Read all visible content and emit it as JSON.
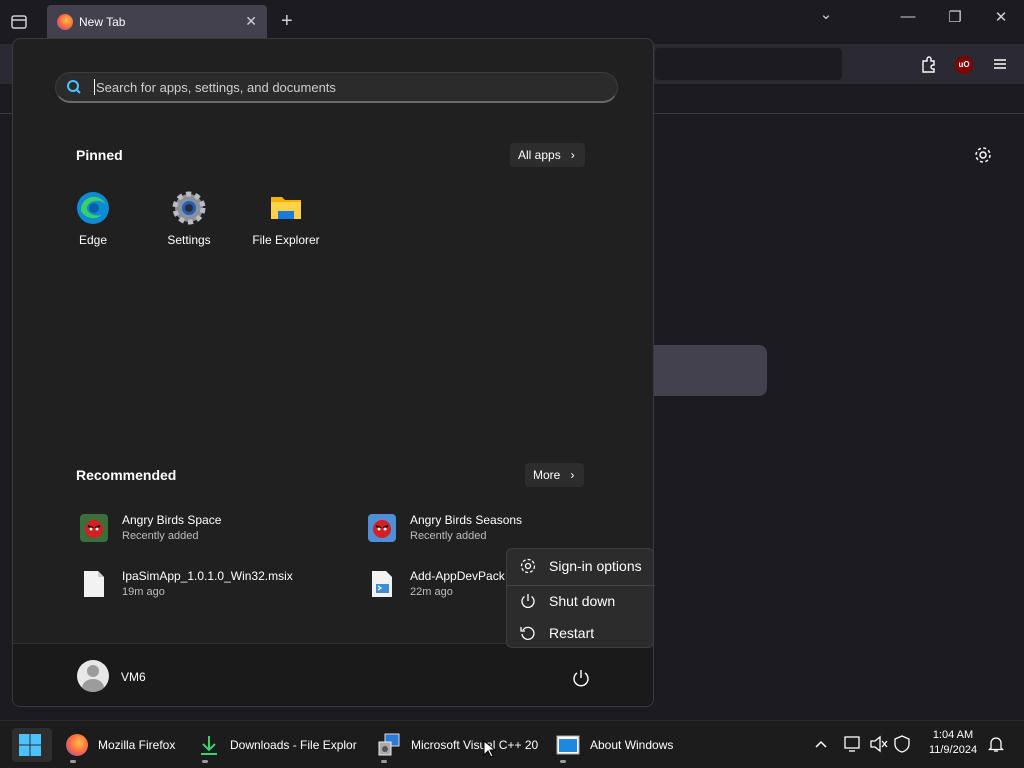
{
  "browser": {
    "tab_title": "New Tab",
    "tab_close": "✕",
    "new_tab": "+",
    "tabs_dropdown": "⌄",
    "minimize": "—",
    "restore": "❐",
    "close": "✕"
  },
  "start_menu": {
    "search_placeholder": "Search for apps, settings, and documents",
    "pinned_title": "Pinned",
    "all_apps_label": "All apps",
    "pinned": [
      {
        "label": "Edge",
        "icon": "edge-icon"
      },
      {
        "label": "Settings",
        "icon": "settings-gear-icon"
      },
      {
        "label": "File Explorer",
        "icon": "folder-icon"
      }
    ],
    "recommended_title": "Recommended",
    "more_label": "More",
    "recommended": [
      {
        "name": "Angry Birds Space",
        "sub": "Recently added",
        "icon": "angry-birds-icon"
      },
      {
        "name": "Angry Birds Seasons",
        "sub": "Recently added",
        "icon": "angry-birds-icon"
      },
      {
        "name": "IpaSimApp_1.0.1.0_Win32.msix",
        "sub": "19m ago",
        "icon": "file-icon"
      },
      {
        "name": "Add-AppDevPack",
        "sub": "22m ago",
        "icon": "script-file-icon"
      }
    ],
    "user_name": "VM6"
  },
  "power_menu": {
    "sign_in": "Sign-in options",
    "shut_down": "Shut down",
    "restart": "Restart"
  },
  "taskbar": {
    "apps": [
      {
        "label": "Mozilla Firefox",
        "icon": "firefox-icon"
      },
      {
        "label": "Downloads - File Explor",
        "icon": "download-icon"
      },
      {
        "label": "Microsoft Visual C++ 20",
        "icon": "installer-icon"
      },
      {
        "label": "About Windows",
        "icon": "window-icon"
      }
    ],
    "time": "1:04 AM",
    "date": "11/9/2024"
  },
  "colors": {
    "accent": "#0078d4",
    "start_bg": "#202020",
    "taskbar_bg": "#1c1c1c"
  }
}
